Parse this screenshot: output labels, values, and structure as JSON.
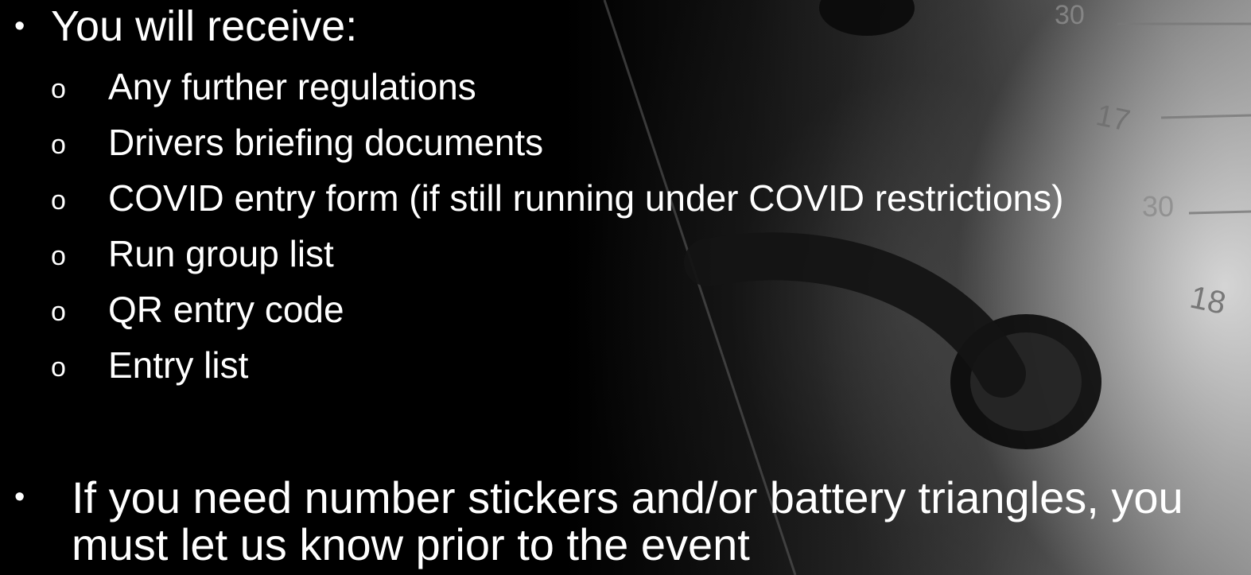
{
  "slide": {
    "heading": "You will receive:",
    "bullet_symbol": "•",
    "sub_marker": "o",
    "items": [
      "Any further regulations",
      "Drivers briefing documents",
      "COVID entry form (if still running under COVID restrictions)",
      "Run group list",
      "QR entry code",
      "Entry list"
    ],
    "note": "If you need number stickers and/or battery triangles, you must let us know prior to the event"
  },
  "background": {
    "calendar_numbers": [
      "30",
      "17",
      "30",
      "18"
    ],
    "text_color": "#ffffff",
    "base_color": "#000000"
  }
}
